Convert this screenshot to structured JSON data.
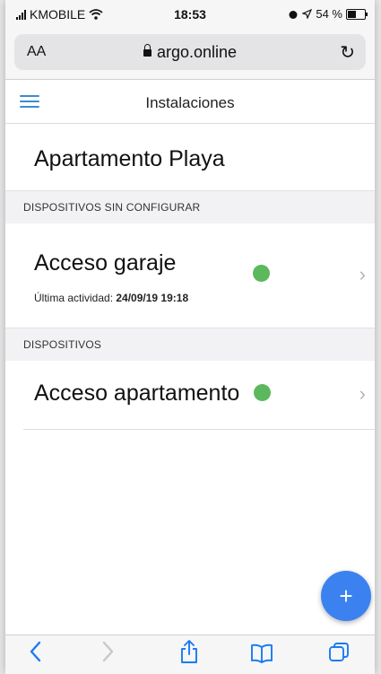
{
  "status_bar": {
    "carrier": "KMOBILE",
    "time": "18:53",
    "battery_percent": "54 %",
    "battery_level": 0.54
  },
  "browser": {
    "text_size_label": "AA",
    "url": "argo.online"
  },
  "app_header": {
    "title": "Instalaciones"
  },
  "page": {
    "title": "Apartamento Playa"
  },
  "sections": [
    {
      "header": "DISPOSITIVOS SIN CONFIGURAR",
      "devices": [
        {
          "name": "Acceso garaje",
          "activity_label": "Última actividad:",
          "activity_value": "24/09/19 19:18",
          "status_color": "#5cb85c"
        }
      ]
    },
    {
      "header": "DISPOSITIVOS",
      "devices": [
        {
          "name": "Acceso apartamento",
          "status_color": "#5cb85c"
        }
      ]
    }
  ],
  "fab": {
    "label": "+"
  },
  "colors": {
    "accent": "#3b82f0",
    "online": "#5cb85c",
    "ios_blue": "#1a7bf2"
  },
  "icons": {
    "menu": "hamburger-icon",
    "back": "chevron-left-icon",
    "forward": "chevron-right-icon",
    "share": "share-icon",
    "bookmarks": "book-icon",
    "tabs": "tabs-icon",
    "reload": "reload-icon",
    "lock": "lock-icon"
  }
}
